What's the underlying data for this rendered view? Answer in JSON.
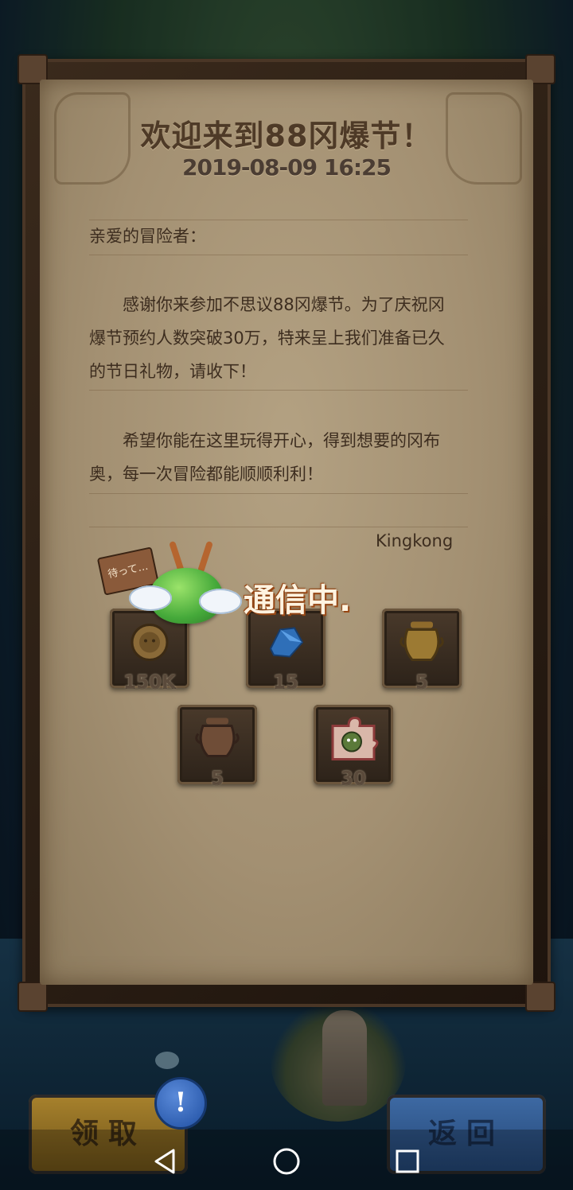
{
  "letter": {
    "title": "欢迎来到88冈爆节！",
    "date": "2019-08-09 16:25",
    "salutation": "亲爱的冒险者：",
    "paragraph1": {
      "line1": "　　感谢你来参加不思议88冈爆节。为了庆祝冈",
      "line2": "爆节预约人数突破30万，特来呈上我们准备已久",
      "line3": "的节日礼物，请收下！"
    },
    "paragraph2": {
      "line1": "　　希望你能在这里玩得开心，得到想要的冈布",
      "line2": "奥，每一次冒险都能顺顺利利！"
    },
    "signature": "Kingkong"
  },
  "loading": {
    "label": "通信中.",
    "sign_text": "待って…"
  },
  "rewards": [
    {
      "icon": "coin-icon",
      "count": "150K"
    },
    {
      "icon": "blue-crystal-icon",
      "count": "15"
    },
    {
      "icon": "gold-pot-icon",
      "count": "5"
    },
    {
      "icon": "bronze-pot-icon",
      "count": "5"
    },
    {
      "icon": "puzzle-piece-icon",
      "count": "30"
    }
  ],
  "buttons": {
    "claim": "领取",
    "back": "返回",
    "alert": "!"
  },
  "colors": {
    "claim_button": "#a8822d",
    "back_button": "#3e6aa4",
    "paper": "#a39072",
    "loading_text": "#fff3e0"
  }
}
